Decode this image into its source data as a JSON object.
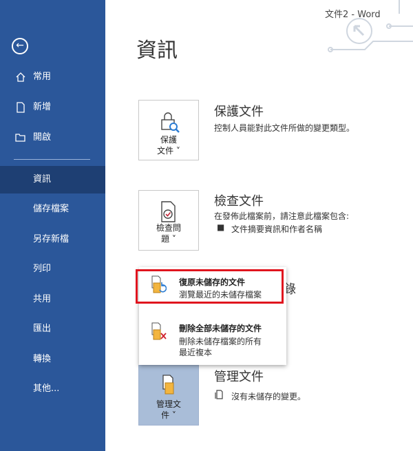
{
  "window": {
    "title": "文件2  -  Word"
  },
  "sidebar": {
    "items": [
      {
        "label": "常用",
        "icon": "home-icon"
      },
      {
        "label": "新增",
        "icon": "new-document-icon"
      },
      {
        "label": "開啟",
        "icon": "folder-open-icon"
      },
      {
        "label": "資訊"
      },
      {
        "label": "儲存檔案"
      },
      {
        "label": "另存新檔"
      },
      {
        "label": "列印"
      },
      {
        "label": "共用"
      },
      {
        "label": "匯出"
      },
      {
        "label": "轉換"
      },
      {
        "label": "其他..."
      }
    ],
    "active_item": "資訊"
  },
  "main": {
    "title": "資訊",
    "protect": {
      "button_line1": "保護",
      "button_line2": "文件 ˅",
      "title": "保護文件",
      "desc": "控制人員能對此文件所做的變更類型。"
    },
    "inspect": {
      "button_line1": "檢查問",
      "button_line2": "題 ˅",
      "title": "檢查文件",
      "desc": "在發佈此檔案前，請注意此檔案包含:",
      "bullet": "文件摘要資訊和作者名稱"
    },
    "partial_title_suffix": "錄",
    "manage": {
      "button_line1": "管理文",
      "button_line2": "件 ˅",
      "title": "管理文件",
      "desc": "沒有未儲存的變更。"
    },
    "popup": {
      "items": [
        {
          "title": "復原未儲存的文件",
          "desc": "瀏覽最近的未儲存檔案"
        },
        {
          "title": "刪除全部未儲存的文件",
          "desc_line1": "刪除未儲存檔案的所有",
          "desc_line2": "最近複本"
        }
      ]
    }
  },
  "colors": {
    "sidebar": "#2b579a",
    "sidebar_active": "#1e3f73",
    "highlight": "#e0141e",
    "manage_card": "#a9bdd8"
  }
}
